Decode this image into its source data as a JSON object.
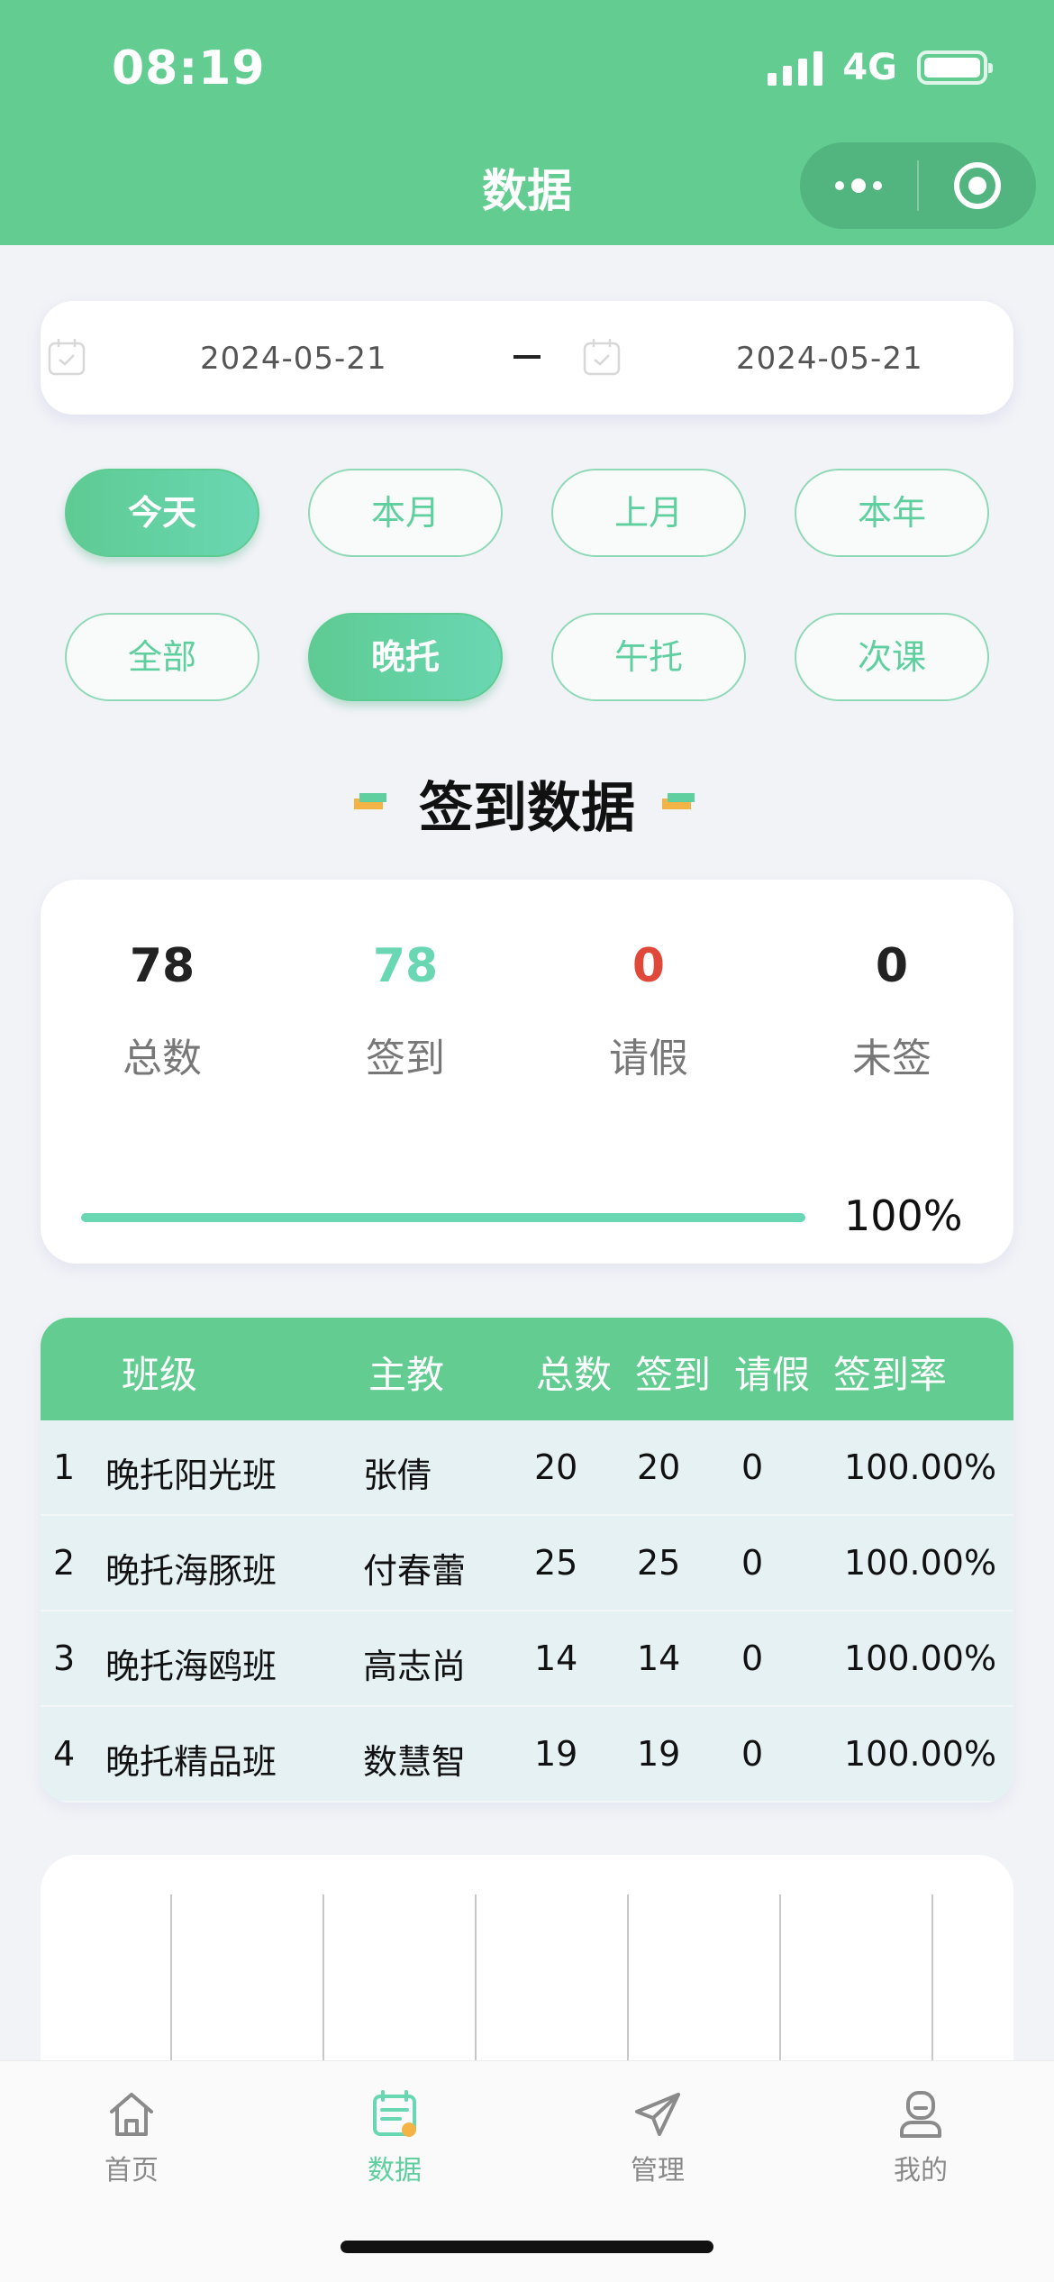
{
  "status_bar": {
    "time": "08:19",
    "network": "4G"
  },
  "header": {
    "title": "数据"
  },
  "date_range": {
    "start": "2024-05-21",
    "end": "2024-05-21"
  },
  "period_filters": [
    "今天",
    "本月",
    "上月",
    "本年"
  ],
  "period_selected": "今天",
  "type_filters": [
    "全部",
    "晚托",
    "午托",
    "次课"
  ],
  "type_selected": "晚托",
  "section_title": "签到数据",
  "stats": [
    {
      "value": "78",
      "label": "总数",
      "color": "#222222"
    },
    {
      "value": "78",
      "label": "签到",
      "color": "#6ad7b3"
    },
    {
      "value": "0",
      "label": "请假",
      "color": "#e0483a"
    },
    {
      "value": "0",
      "label": "未签",
      "color": "#222222"
    }
  ],
  "progress": {
    "value": 100,
    "text": "100%"
  },
  "table": {
    "headers": [
      "班级",
      "主教",
      "总数",
      "签到",
      "请假",
      "签到率"
    ],
    "rows": [
      [
        "1",
        "晚托阳光班",
        "张倩",
        "20",
        "20",
        "0",
        "100.00%"
      ],
      [
        "2",
        "晚托海豚班",
        "付春蕾",
        "25",
        "25",
        "0",
        "100.00%"
      ],
      [
        "3",
        "晚托海鸥班",
        "高志尚",
        "14",
        "14",
        "0",
        "100.00%"
      ],
      [
        "4",
        "晚托精品班",
        "数慧智",
        "19",
        "19",
        "0",
        "100.00%"
      ]
    ]
  },
  "tabbar": [
    {
      "label": "首页",
      "icon": "home-icon",
      "active": false
    },
    {
      "label": "数据",
      "icon": "data-icon",
      "active": true
    },
    {
      "label": "管理",
      "icon": "send-icon",
      "active": false
    },
    {
      "label": "我的",
      "icon": "user-icon",
      "active": false
    }
  ],
  "colors": {
    "primary": "#62cc91",
    "accent": "#6ad7b3",
    "danger": "#e0483a",
    "decoration": "#f3b445"
  }
}
